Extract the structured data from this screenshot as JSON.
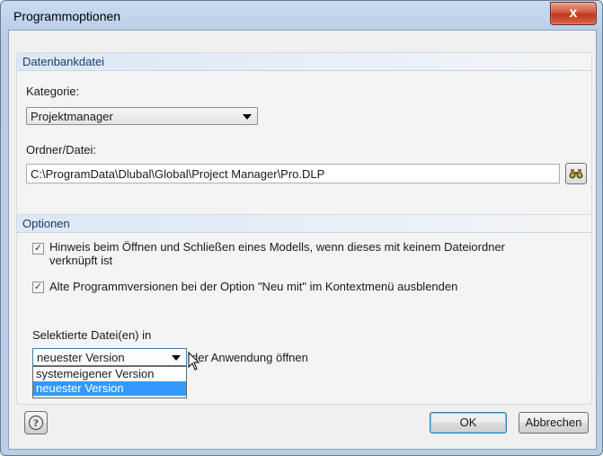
{
  "window": {
    "title": "Programmoptionen",
    "close_glyph": "x"
  },
  "database_group": {
    "header": "Datenbankdatei",
    "category_label": "Kategorie:",
    "category_value": "Projektmanager",
    "folder_label": "Ordner/Datei:",
    "folder_value": "C:\\ProgramData\\Dlubal\\Global\\Project Manager\\Pro.DLP",
    "browse_icon": "binoculars-icon"
  },
  "options_group": {
    "header": "Optionen",
    "checkbox1_line1": "Hinweis beim Öffnen und Schließen eines Modells, wenn dieses mit keinem Dateiordner",
    "checkbox1_line2": "verknüpft ist",
    "checkbox1_checked": true,
    "checkbox2_label": "Alte Programmversionen bei der Option \"Neu mit\" im Kontextmenü ausblenden",
    "checkbox2_checked": true,
    "selected_files_label": "Selektierte Datei(en) in",
    "version_value": "neuester Version",
    "version_suffix": "der Anwendung öffnen",
    "version_options": [
      "systemeigener Version",
      "neuester Version"
    ]
  },
  "footer": {
    "help_icon": "help-icon",
    "ok_label": "OK",
    "cancel_label": "Abbrechen"
  }
}
